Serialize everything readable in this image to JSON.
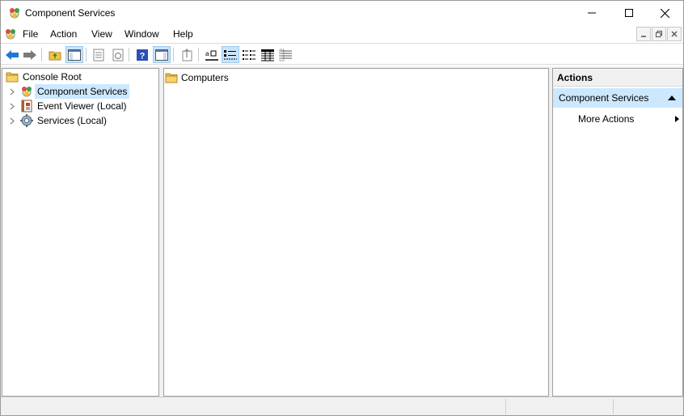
{
  "window": {
    "title": "Component Services",
    "app_icon": "component-services-icon"
  },
  "menu": {
    "items": [
      "File",
      "Action",
      "View",
      "Window",
      "Help"
    ]
  },
  "toolbar": {
    "buttons": [
      "back-arrow",
      "forward-arrow",
      "up-folder",
      "show-hide-console-tree",
      "properties",
      "refresh",
      "help",
      "show-hide-action-pane",
      "export-list",
      "large-icons",
      "small-icons",
      "list-view",
      "detail-view",
      "configure-view"
    ]
  },
  "tree": {
    "root": "Console Root",
    "items": [
      {
        "label": "Component Services",
        "selected": true,
        "icon": "component-services-icon"
      },
      {
        "label": "Event Viewer (Local)",
        "selected": false,
        "icon": "event-viewer-icon"
      },
      {
        "label": "Services (Local)",
        "selected": false,
        "icon": "services-gear-icon"
      }
    ]
  },
  "results": {
    "items": [
      {
        "label": "Computers",
        "icon": "folder-icon"
      }
    ]
  },
  "actions": {
    "header": "Actions",
    "group": "Component Services",
    "items": [
      "More Actions"
    ]
  },
  "colors": {
    "selection": "#cce8ff",
    "pressed": "#cce4f7",
    "folder": "#f2c14e",
    "nav_arrow": "#1e78d7"
  }
}
